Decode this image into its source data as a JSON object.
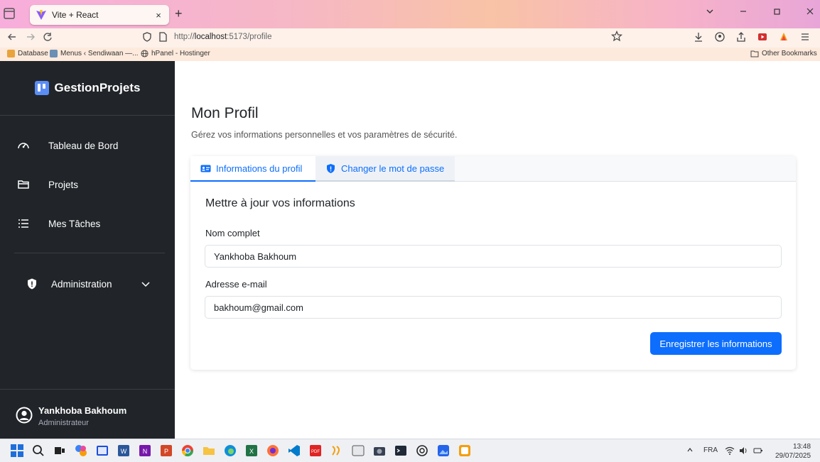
{
  "browser": {
    "tab_title": "Vite + React",
    "tab_close": "×",
    "new_tab": "+",
    "url_prefix": "http://",
    "url_host": "localhost",
    "url_path": ":5173/profile",
    "bookmarks": [
      "Database",
      "Menus ‹ Sendiwaan —...",
      "hPanel - Hostinger"
    ],
    "other_bookmarks": "Other Bookmarks"
  },
  "sidebar": {
    "brand": "GestionProjets",
    "items": [
      {
        "label": "Tableau de Bord",
        "icon": "gauge-icon"
      },
      {
        "label": "Projets",
        "icon": "folder-icon"
      },
      {
        "label": "Mes Tâches",
        "icon": "list-icon"
      }
    ],
    "admin_label": "Administration",
    "user_name": "Yankhoba Bakhoum",
    "user_role": "Administrateur"
  },
  "main": {
    "title": "Mon Profil",
    "subtitle": "Gérez vos informations personnelles et vos paramètres de sécurité.",
    "tabs": [
      {
        "label": "Informations du profil",
        "icon": "id-card-icon"
      },
      {
        "label": "Changer le mot de passe",
        "icon": "shield-icon"
      }
    ],
    "card_title": "Mettre à jour vos informations",
    "name_label": "Nom complet",
    "name_value": "Yankhoba Bakhoum",
    "email_label": "Adresse e-mail",
    "email_value": "bakhoum@gmail.com",
    "save_label": "Enregistrer les informations"
  },
  "taskbar": {
    "lang": "FRA",
    "time": "13:48",
    "date": "29/07/2025"
  },
  "colors": {
    "accent": "#0d6efd",
    "sidebar_bg": "#212529"
  }
}
